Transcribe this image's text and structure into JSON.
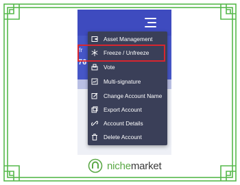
{
  "colors": {
    "frame": "#55b84a",
    "header": "#3e4bbf",
    "menu_bg": "#3a3f58",
    "highlight": "#d8262f",
    "logo_green": "#5aa845",
    "logo_dark": "#3a3a3a"
  },
  "menu": {
    "items": [
      {
        "label": "Asset Management",
        "icon": "wallet-icon"
      },
      {
        "label": "Freeze / Unfreeze",
        "icon": "snowflake-icon",
        "highlighted": true
      },
      {
        "label": "Vote",
        "icon": "vote-icon"
      },
      {
        "label": "Multi-signature",
        "icon": "multisig-icon"
      },
      {
        "label": "Change Account Name",
        "icon": "edit-icon"
      },
      {
        "label": "Export Account",
        "icon": "export-icon"
      },
      {
        "label": "Account Details",
        "icon": "link-icon"
      },
      {
        "label": "Delete Account",
        "icon": "trash-icon"
      }
    ]
  },
  "background_peek": {
    "text_1": "fr",
    "text_2": "76"
  },
  "logo": {
    "text_a": "niche",
    "text_b": "market",
    "icon": "niche-logo-icon"
  }
}
